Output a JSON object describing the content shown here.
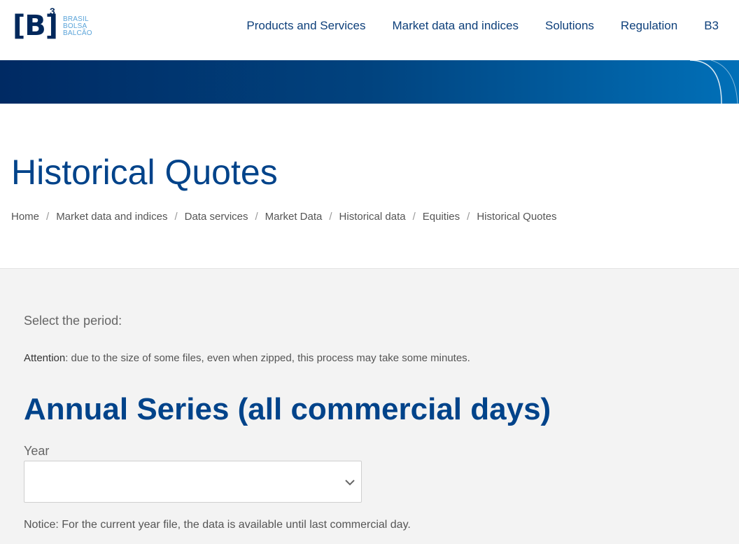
{
  "header": {
    "logo": {
      "mark": "[B]",
      "superscript": "3",
      "lines": [
        "BRASIL",
        "BOLSA",
        "BALCÃO"
      ]
    },
    "nav": [
      {
        "label": "Products and Services"
      },
      {
        "label": "Market data and indices"
      },
      {
        "label": "Solutions"
      },
      {
        "label": "Regulation"
      },
      {
        "label": "B3"
      }
    ]
  },
  "page": {
    "title": "Historical Quotes",
    "breadcrumb": [
      "Home",
      "Market data and indices",
      "Data services",
      "Market Data",
      "Historical data",
      "Equities",
      "Historical Quotes"
    ],
    "breadcrumb_separator": "/"
  },
  "content": {
    "select_period": "Select the period:",
    "attention_label": "Attention",
    "attention_text": ": due to the size of some files, even when zipped, this process may take some minutes.",
    "section_title": "Annual Series (all commercial days)",
    "year_label": "Year",
    "year_value": "",
    "notice": "Notice: For the current year file, the data is available until last commercial day."
  },
  "colors": {
    "brand_navy": "#00285c",
    "title_blue": "#00438a",
    "logo_light_blue": "#5ba4d9"
  }
}
